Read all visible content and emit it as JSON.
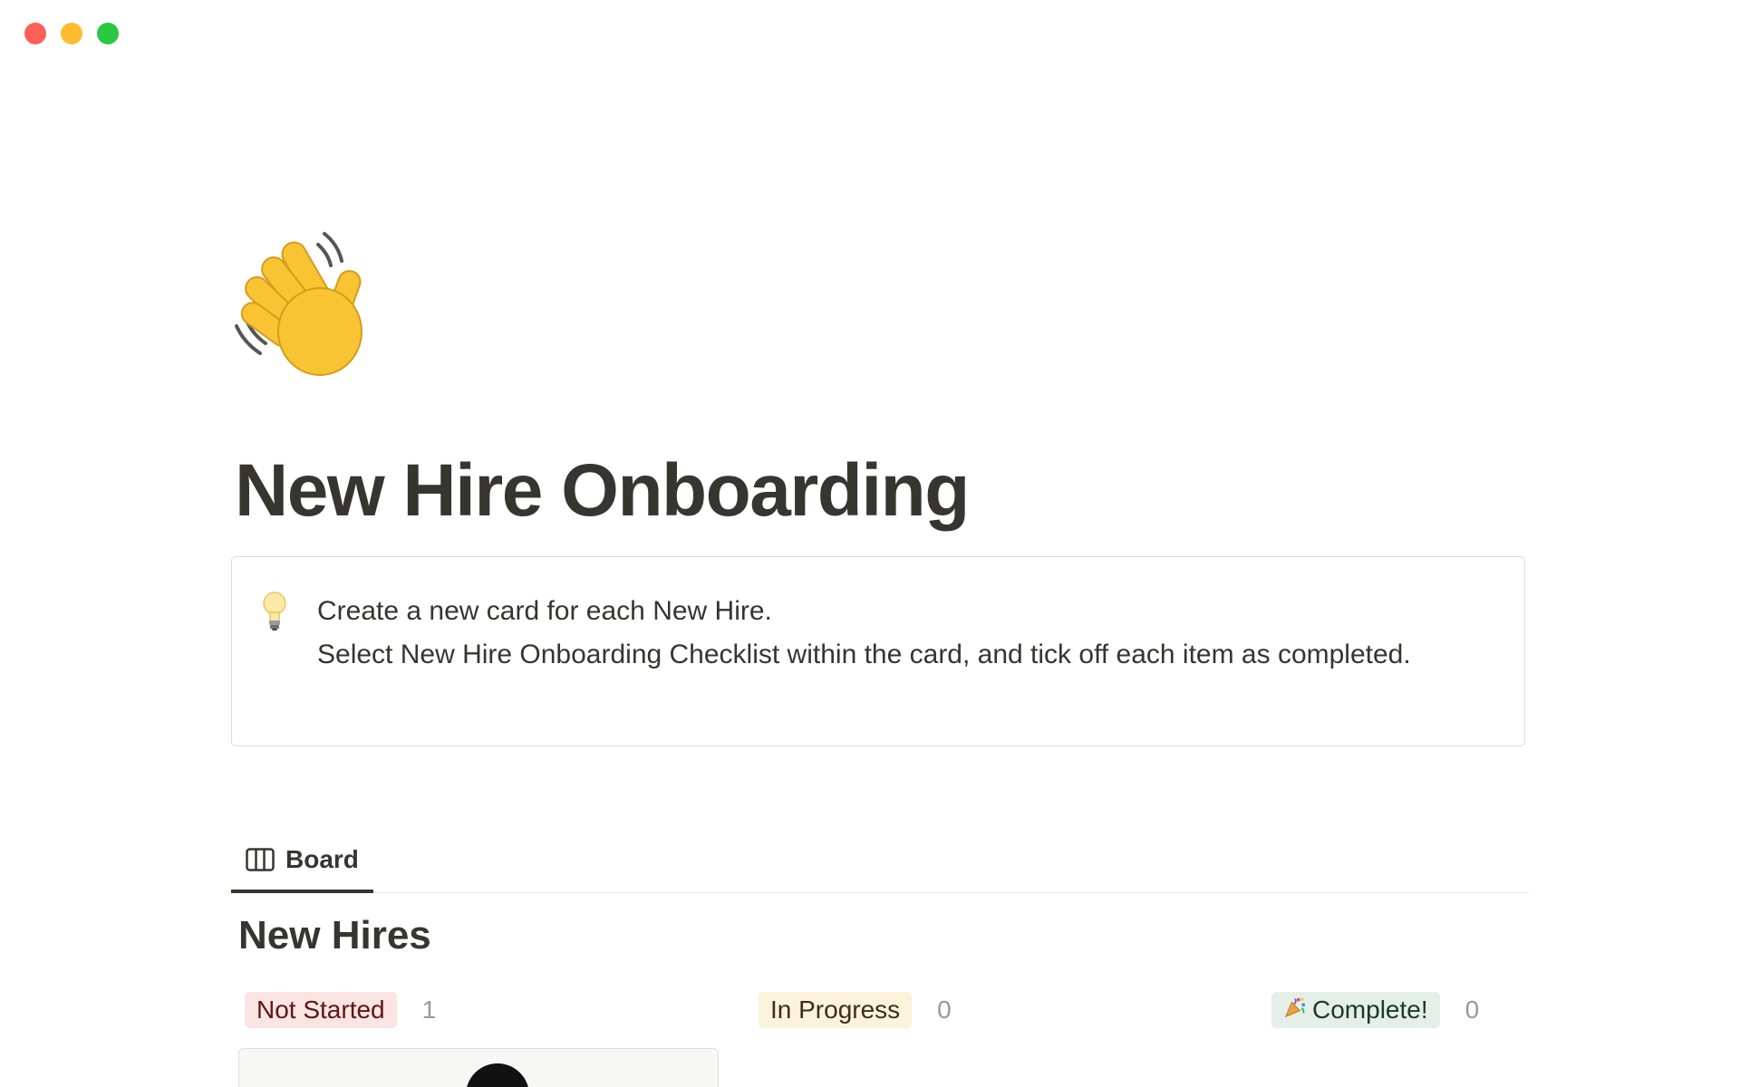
{
  "window": {
    "traffic_lights": [
      "close",
      "minimize",
      "zoom"
    ],
    "colors": {
      "close": "#fe5f57",
      "minimize": "#febc2e",
      "zoom": "#28c840"
    }
  },
  "page": {
    "icon": "waving-hand-icon",
    "title": "New Hire Onboarding"
  },
  "callout": {
    "icon": "light-bulb-icon",
    "lines": [
      "Create a new card for each New Hire.",
      "Select New Hire Onboarding Checklist within the card, and tick off each item as completed."
    ]
  },
  "views": {
    "tabs": [
      {
        "label": "Board",
        "icon": "board-view-icon",
        "active": true
      }
    ]
  },
  "board": {
    "title": "New Hires",
    "columns": [
      {
        "label": "Not Started",
        "count": "1",
        "bg": "#fbe4e4",
        "fg": "#5d1715"
      },
      {
        "label": "In Progress",
        "count": "0",
        "bg": "#fbf3db",
        "fg": "#402c1b"
      },
      {
        "label": "Complete!",
        "icon": "party-popper-icon",
        "count": "0",
        "bg": "#e5efe7",
        "fg": "#1c3829"
      }
    ]
  }
}
